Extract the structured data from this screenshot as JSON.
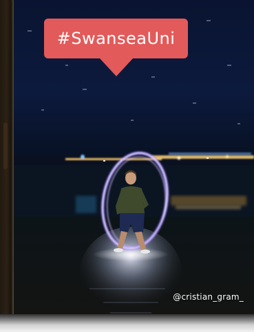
{
  "hashtag_label": "#SwanseaUni",
  "photo_credit": "@cristian_gram_",
  "colors": {
    "tag_background": "#e35a5a",
    "night_sky": "#0b1633",
    "light_ring": "#b79cff"
  }
}
